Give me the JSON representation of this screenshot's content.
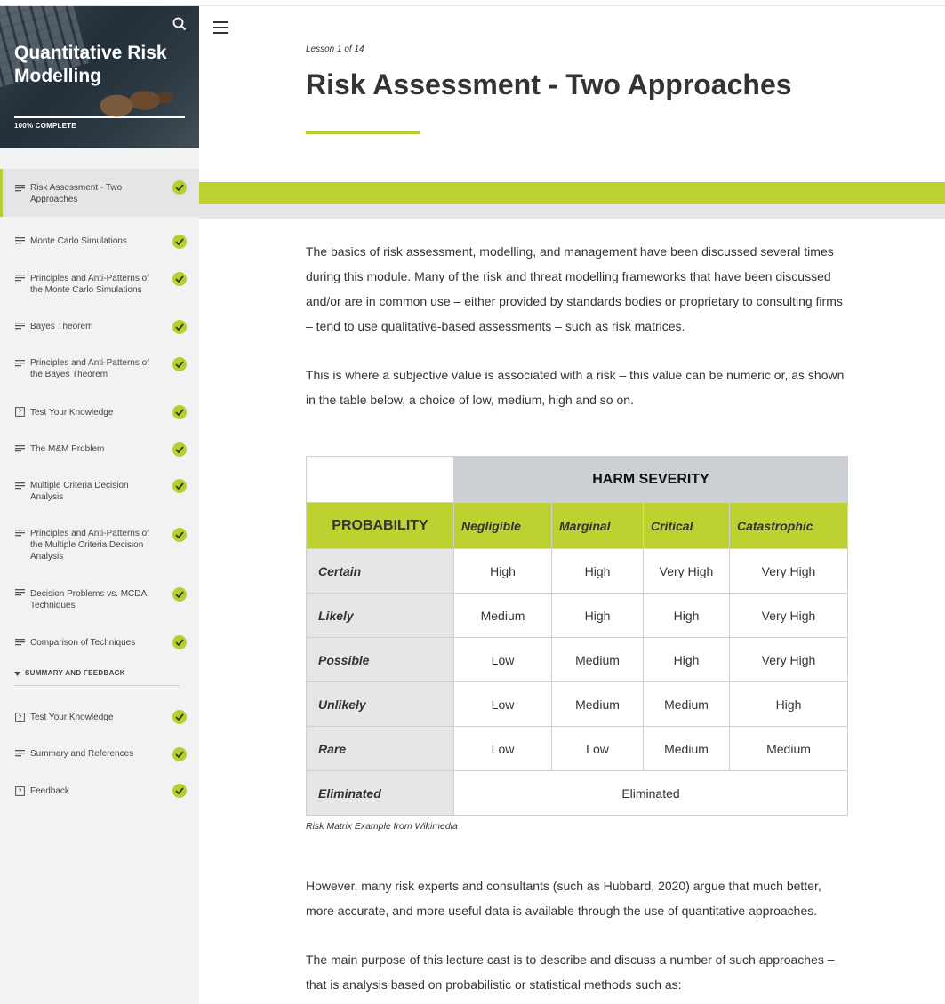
{
  "sidebar": {
    "course_title": "Quantitative Risk Modelling",
    "progress_label": "100% COMPLETE",
    "progress_percent": 100,
    "items": [
      {
        "label": "Risk Assessment - Two Approaches",
        "icon": "text-lines-icon",
        "completed": true,
        "active": true
      },
      {
        "label": "Monte Carlo Simulations",
        "icon": "text-lines-icon",
        "completed": true
      },
      {
        "label": "Principles and Anti-Patterns of the Monte Carlo Simulations",
        "icon": "text-lines-icon",
        "completed": true
      },
      {
        "label": "Bayes Theorem",
        "icon": "text-lines-icon",
        "completed": true
      },
      {
        "label": "Principles and Anti-Patterns of the Bayes Theorem",
        "icon": "text-lines-icon",
        "completed": true
      },
      {
        "label": "Test Your Knowledge",
        "icon": "quiz-icon",
        "completed": true
      },
      {
        "label": "The M&M Problem",
        "icon": "text-lines-icon",
        "completed": true
      },
      {
        "label": "Multiple Criteria Decision Analysis",
        "icon": "text-lines-icon",
        "completed": true
      },
      {
        "label": "Principles and Anti-Patterns of the Multiple Criteria Decision Analysis",
        "icon": "text-lines-icon",
        "completed": true
      },
      {
        "label": "Decision Problems vs. MCDA Techniques",
        "icon": "text-lines-icon",
        "completed": true
      },
      {
        "label": "Comparison of Techniques",
        "icon": "text-lines-icon",
        "completed": true
      }
    ],
    "section": {
      "title": "SUMMARY AND FEEDBACK",
      "items": [
        {
          "label": "Test Your Knowledge",
          "icon": "quiz-icon",
          "completed": true
        },
        {
          "label": "Summary and References",
          "icon": "text-lines-icon",
          "completed": true
        },
        {
          "label": "Feedback",
          "icon": "quiz-icon",
          "completed": true
        }
      ]
    }
  },
  "main": {
    "lesson_counter": "Lesson 1 of 14",
    "title": "Risk Assessment - Two Approaches",
    "para1": "The basics of risk assessment, modelling, and management have been discussed several times during this module. Many of the risk and threat modelling frameworks that have been discussed and/or are in common use – either provided by standards bodies or proprietary to consulting firms – tend to use qualitative-based assessments – such as risk matrices.",
    "para2": "This is where a subjective value is associated with a risk – this value can be numeric or, as shown in the table below, a choice of low, medium, high and so on.",
    "table": {
      "harm_header": "HARM SEVERITY",
      "prob_header": "PROBABILITY",
      "severities": [
        "Negligible",
        "Marginal",
        "Critical",
        "Catastrophic"
      ],
      "rows": [
        {
          "label": "Certain",
          "values": [
            "High",
            "High",
            "Very High",
            "Very High"
          ]
        },
        {
          "label": "Likely",
          "values": [
            "Medium",
            "High",
            "High",
            "Very High"
          ]
        },
        {
          "label": "Possible",
          "values": [
            "Low",
            "Medium",
            "High",
            "Very High"
          ]
        },
        {
          "label": "Unlikely",
          "values": [
            "Low",
            "Medium",
            "Medium",
            "High"
          ]
        },
        {
          "label": "Rare",
          "values": [
            "Low",
            "Low",
            "Medium",
            "Medium"
          ]
        }
      ],
      "eliminated_label": "Eliminated",
      "eliminated_value": "Eliminated"
    },
    "caption": "Risk Matrix Example from Wikimedia",
    "para3": "However, many risk experts and consultants (such as Hubbard, 2020) argue that much better, more accurate, and more useful data is available through the use of quantitative approaches.",
    "para4": "The main purpose of this lecture cast is to describe and discuss a number of such approaches – that is analysis based on probabilistic or statistical methods such as:"
  },
  "colors": {
    "accent": "#bdd130",
    "header_gray": "#ccd0d4",
    "row_gray": "#e6e6e6"
  }
}
